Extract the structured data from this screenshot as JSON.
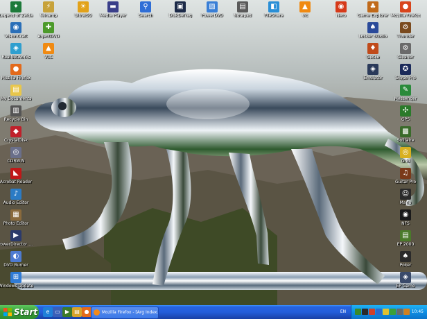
{
  "desktop": {
    "icons": [
      {
        "id": "legend-of-zelda",
        "label": "Legend of Zelda",
        "symbol": "✦",
        "color": "#1d7a3a"
      },
      {
        "id": "visioncraft",
        "label": "VisionCraft",
        "symbol": "◉",
        "color": "#2a6fb8"
      },
      {
        "id": "realnetworks",
        "label": "RealNetworks",
        "symbol": "◈",
        "color": "#2f9fcf"
      },
      {
        "id": "firefox",
        "label": "Mozilla Firefox",
        "symbol": "●",
        "color": "#e36a1b"
      },
      {
        "id": "my-docs",
        "label": "My Documents",
        "symbol": "▤",
        "color": "#e8c64a"
      },
      {
        "id": "recycle",
        "label": "Recycle Bin",
        "symbol": "▥",
        "color": "#555555"
      },
      {
        "id": "crystal",
        "label": "CrystalDisk",
        "symbol": "◆",
        "color": "#c0202a"
      },
      {
        "id": "cdr-win",
        "label": "CDRWIN",
        "symbol": "◎",
        "color": "#6a6f8a"
      },
      {
        "id": "acrobat",
        "label": "Acrobat Reader",
        "symbol": "◣",
        "color": "#c01818"
      },
      {
        "id": "audio-editor",
        "label": "Audio Editor",
        "symbol": "♪",
        "color": "#2b7bc4"
      },
      {
        "id": "photo-editor",
        "label": "Photo Editor",
        "symbol": "▦",
        "color": "#8a6a3c"
      },
      {
        "id": "power-director",
        "label": "PowerDirector Pro",
        "symbol": "▶",
        "color": "#2b3a6b"
      },
      {
        "id": "dvd-burn",
        "label": "DVD Burner",
        "symbol": "◐",
        "color": "#4e7bd1"
      },
      {
        "id": "windows-update",
        "label": "Windows Update",
        "symbol": "⊞",
        "color": "#2f7bd6"
      },
      {
        "id": "winamp",
        "label": "Winamp",
        "symbol": "⚡",
        "color": "#c7a23a"
      },
      {
        "id": "agent-dvd",
        "label": "AgentDVD",
        "symbol": "✚",
        "color": "#4c9a2a"
      },
      {
        "id": "vlc",
        "label": "VLC",
        "symbol": "▲",
        "color": "#f08a12"
      },
      {
        "id": "ultraiso",
        "label": "UltraISO",
        "symbol": "☀",
        "color": "#e2a21a"
      },
      {
        "id": "media-player",
        "label": "Media Player",
        "symbol": "▬",
        "color": "#3a3f8a"
      },
      {
        "id": "search",
        "label": "Search",
        "symbol": "⚲",
        "color": "#2f6ed6"
      },
      {
        "id": "disk-defrag",
        "label": "DiskDefrag",
        "symbol": "▣",
        "color": "#1c2a48"
      },
      {
        "id": "powerdvd",
        "label": "PowerDVD",
        "symbol": "▧",
        "color": "#3a7fd6"
      },
      {
        "id": "notepad",
        "label": "Notepad",
        "symbol": "▤",
        "color": "#5a5a5a"
      },
      {
        "id": "fileshare",
        "label": "FileShare",
        "symbol": "◧",
        "color": "#2a8fd6"
      },
      {
        "id": "vlc-2",
        "label": "vlc",
        "symbol": "▲",
        "color": "#f08a12"
      },
      {
        "id": "nero",
        "label": "Nero",
        "symbol": "◉",
        "color": "#d63a1a"
      },
      {
        "id": "game-explorer",
        "label": "Game Explorer",
        "symbol": "♣",
        "color": "#c06a1a"
      },
      {
        "id": "mozilla",
        "label": "Mozilla Firefox",
        "symbol": "●",
        "color": "#d8451c"
      },
      {
        "id": "thunder",
        "label": "Thunder",
        "symbol": "⚙",
        "color": "#7a4a1e"
      },
      {
        "id": "cleaner",
        "label": "Cleaner",
        "symbol": "⚙",
        "color": "#6a6a6a"
      },
      {
        "id": "locker",
        "label": "Locker Studio",
        "symbol": "♠",
        "color": "#2a4a9a"
      },
      {
        "id": "gecko",
        "label": "Gecko",
        "symbol": "♦",
        "color": "#c04a1a"
      },
      {
        "id": "emulator",
        "label": "Emulator",
        "symbol": "◈",
        "color": "#2a3a5a"
      },
      {
        "id": "skype",
        "label": "Skype Pro",
        "symbol": "✪",
        "color": "#1a2a5a"
      },
      {
        "id": "messenger",
        "label": "Messenger",
        "symbol": "✎",
        "color": "#2a8a3a"
      },
      {
        "id": "gps",
        "label": "GPS",
        "symbol": "✣",
        "color": "#2a7a2a"
      },
      {
        "id": "solitaire",
        "label": "Solitaire",
        "symbol": "▩",
        "color": "#3a6a2a"
      },
      {
        "id": "grid",
        "label": "Grid",
        "symbol": "◎",
        "color": "#d8b020"
      },
      {
        "id": "guitar",
        "label": "Guitar Pro",
        "symbol": "♫",
        "color": "#7a3a1a"
      },
      {
        "id": "mario",
        "label": "Mario",
        "symbol": "☺",
        "color": "#2a2a2a"
      },
      {
        "id": "nfs",
        "label": "NFS",
        "symbol": "◉",
        "color": "#1a1a1a"
      },
      {
        "id": "ep-2000",
        "label": "EP 2000",
        "symbol": "▤",
        "color": "#4a7a2a"
      },
      {
        "id": "poker",
        "label": "Poker",
        "symbol": "♠",
        "color": "#2a2a2a"
      },
      {
        "id": "ep-game",
        "label": "EP Game",
        "symbol": "◈",
        "color": "#3a4a6a"
      }
    ]
  },
  "taskbar": {
    "start_label": "Start",
    "quick_launch": [
      {
        "id": "ie",
        "symbol": "e",
        "color": "#1f7fd8"
      },
      {
        "id": "desktop",
        "symbol": "▭",
        "color": "#3a5fb8"
      },
      {
        "id": "media",
        "symbol": "▶",
        "color": "#3c7a2a"
      },
      {
        "id": "folder",
        "symbol": "▤",
        "color": "#d6a22a"
      },
      {
        "id": "firefox",
        "symbol": "●",
        "color": "#e36a1b"
      }
    ],
    "window_button": "Mozilla Firefox - [Arg Index...]",
    "language": "EN",
    "tray_icons": [
      "#3a8a2a",
      "#2a2a2a",
      "#d0402a",
      "#2a6ad0",
      "#e0c030",
      "#3aa03a",
      "#6a6a6a",
      "#d08020"
    ],
    "clock": "10:45"
  }
}
